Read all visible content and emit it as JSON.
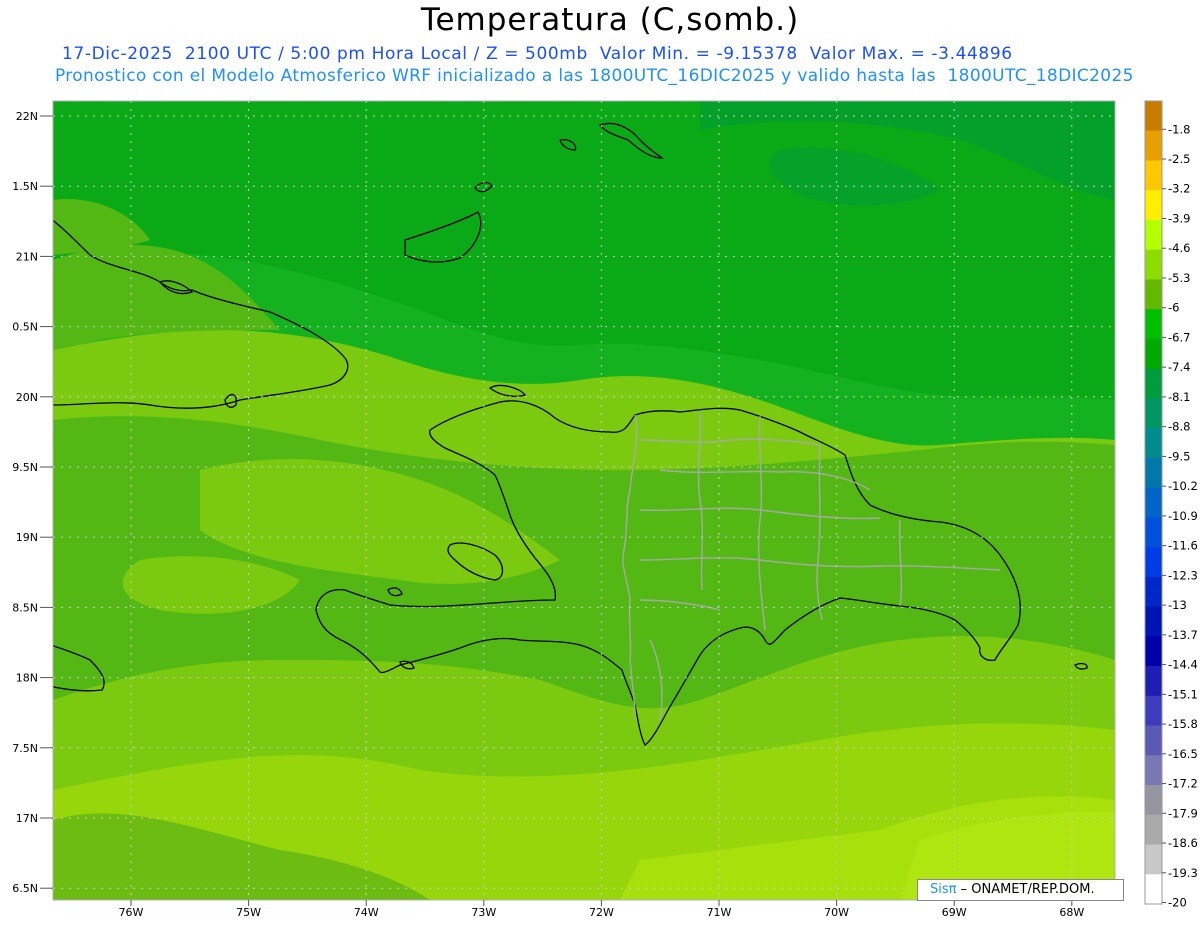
{
  "header": {
    "title": "Temperatura (C,somb.)",
    "line1": "17-Dic-2025  2100 UTC / 5:00 pm Hora Local / Z = 500mb  Valor Min. = -9.15378  Valor Max. = -3.44896",
    "line2": "Pronostico con el Modelo Atmosferico WRF inicializado a las 1800UTC_16DIC2025 y valido hasta las  1800UTC_18DIC2025"
  },
  "map": {
    "lat_labels": [
      "22N",
      "1.5N",
      "21N",
      "0.5N",
      "20N",
      "9.5N",
      "19N",
      "8.5N",
      "18N",
      "7.5N",
      "17N",
      "6.5N"
    ],
    "lon_labels": [
      "76W",
      "75W",
      "74W",
      "73W",
      "72W",
      "71W",
      "70W",
      "69W",
      "68W"
    ],
    "field_colors": {
      "darkest": "#00a40e",
      "dark": "#15b21f",
      "mid": "#54b814",
      "light": "#7cca10",
      "lighter": "#98d60c",
      "lightest": "#b0e610"
    }
  },
  "colorbar": {
    "labels": [
      "-1.8",
      "-2.5",
      "-3.2",
      "-3.9",
      "-4.6",
      "-5.3",
      "-6",
      "-6.7",
      "-7.4",
      "-8.1",
      "-8.8",
      "-9.5",
      "-10.2",
      "-10.9",
      "-11.6",
      "-12.3",
      "-13",
      "-13.7",
      "-14.4",
      "-15.1",
      "-15.8",
      "-16.5",
      "-17.2",
      "-17.9",
      "-18.6",
      "-19.3",
      "-20"
    ],
    "colors": [
      "#c87d00",
      "#e6a000",
      "#ffc800",
      "#ffee00",
      "#b4ff00",
      "#8cdc00",
      "#64b900",
      "#00be00",
      "#00aa00",
      "#009b3c",
      "#009664",
      "#008c8c",
      "#0078aa",
      "#0064c8",
      "#0050dc",
      "#003ce6",
      "#0028c8",
      "#0014b4",
      "#0000aa",
      "#1e1eb4",
      "#3c3cbe",
      "#5a5ab4",
      "#7878b4",
      "#9696a0",
      "#aaaaaa",
      "#c8c8c8",
      "#ffffff"
    ]
  },
  "credit": {
    "sis": "Sisπ",
    "org": " – ONAMET/REP.DOM."
  }
}
